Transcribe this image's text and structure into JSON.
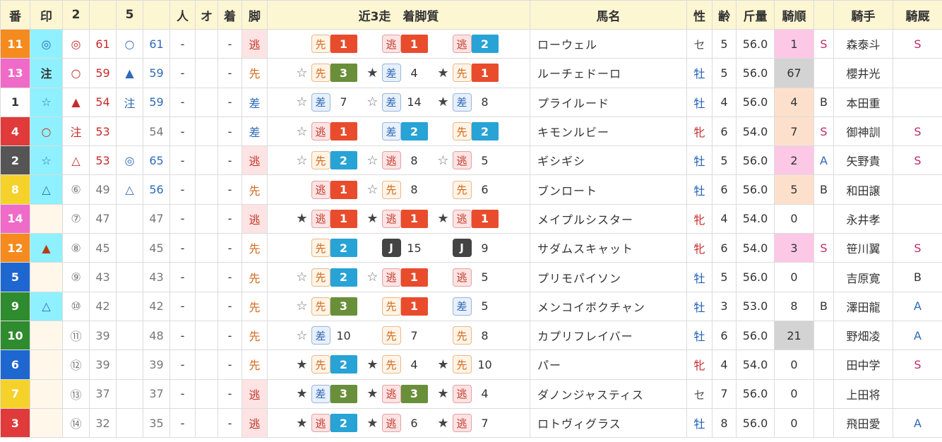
{
  "headers": [
    "番",
    "印",
    "2",
    "",
    "5",
    "",
    "人",
    "オ",
    "着",
    "脚",
    "近3走　着脚質",
    "馬名",
    "性",
    "齢",
    "斤量",
    "騎順",
    "",
    "騎手",
    "騎厩"
  ],
  "colors": {
    "white": "#ffffff",
    "black": "#222222",
    "red": "#e03a3a",
    "blue": "#1e66d0",
    "yellow": "#f5d22a",
    "green": "#2e8b2e",
    "orange": "#f58a1f",
    "pink": "#f06ac8",
    "grey": "#555555",
    "cyan": "#8ff0ff",
    "pos_red": "#e84c2d",
    "pos_blue": "#27a3d6",
    "pos_green": "#6a8f3a"
  },
  "rows": [
    {
      "num": "11",
      "num_color": "#f58a1f",
      "mark": "◎",
      "mark_cls": "",
      "m2": "◎",
      "s2": "61",
      "m5": "○",
      "s5": "61",
      "pop": "-",
      "o": "",
      "chaku": "-",
      "style": "逃",
      "style_cls": "nige",
      "r": [
        {
          "star": "",
          "st": "先",
          "p": "1",
          "pc": "#e84c2d"
        },
        {
          "star": "",
          "st": "逃",
          "p": "1",
          "pc": "#e84c2d"
        },
        {
          "star": "",
          "st": "逃",
          "p": "2",
          "pc": "#27a3d6"
        }
      ],
      "horse": "ローウェル",
      "sex": "セ",
      "sex_cls": "g",
      "age": "5",
      "kin": "56.0",
      "rank": "1",
      "rank_cls": "pink",
      "jk_grade": "S",
      "jockey": "森泰斗",
      "kyu": "S"
    },
    {
      "num": "13",
      "num_color": "#f06ac8",
      "mark": "注",
      "mark_cls": "",
      "m2": "○",
      "s2": "59",
      "m5": "▲",
      "s5": "59",
      "pop": "-",
      "o": "",
      "chaku": "-",
      "style": "先",
      "style_cls": "senk",
      "r": [
        {
          "star": "☆",
          "st": "先",
          "p": "3",
          "pc": "#6a8f3a"
        },
        {
          "star": "★",
          "st": "差",
          "p": "4",
          "pc": ""
        },
        {
          "star": "★",
          "st": "先",
          "p": "1",
          "pc": "#e84c2d"
        }
      ],
      "horse": "ルーチェドーロ",
      "sex": "牡",
      "sex_cls": "c",
      "age": "5",
      "kin": "56.0",
      "rank": "67",
      "rank_cls": "grey",
      "jk_grade": "",
      "jockey": "櫻井光",
      "kyu": ""
    },
    {
      "num": "1",
      "num_color": "#ffffff",
      "mark": "☆",
      "mark_cls": "",
      "m2": "▲",
      "s2": "54",
      "m5": "注",
      "s5": "59",
      "pop": "-",
      "o": "",
      "chaku": "-",
      "style": "差",
      "style_cls": "sash",
      "r": [
        {
          "star": "☆",
          "st": "差",
          "p": "7",
          "pc": ""
        },
        {
          "star": "☆",
          "st": "差",
          "p": "14",
          "pc": ""
        },
        {
          "star": "★",
          "st": "差",
          "p": "8",
          "pc": ""
        }
      ],
      "horse": "プライルード",
      "sex": "牡",
      "sex_cls": "c",
      "age": "4",
      "kin": "56.0",
      "rank": "4",
      "rank_cls": "peach",
      "jk_grade": "B",
      "jockey": "本田重",
      "kyu": ""
    },
    {
      "num": "4",
      "num_color": "#e03a3a",
      "mark": "○",
      "mark_cls": "",
      "m2": "注",
      "s2": "53",
      "m5": "",
      "s5": "54",
      "pop": "-",
      "o": "",
      "chaku": "-",
      "style": "差",
      "style_cls": "sash",
      "r": [
        {
          "star": "☆",
          "st": "逃",
          "p": "1",
          "pc": "#e84c2d"
        },
        {
          "star": "",
          "st": "差",
          "p": "2",
          "pc": "#27a3d6"
        },
        {
          "star": "",
          "st": "先",
          "p": "2",
          "pc": "#27a3d6"
        }
      ],
      "horse": "キモンルビー",
      "sex": "牝",
      "sex_cls": "f",
      "age": "6",
      "kin": "54.0",
      "rank": "7",
      "rank_cls": "peach",
      "jk_grade": "S",
      "jockey": "御神訓",
      "kyu": "S"
    },
    {
      "num": "2",
      "num_color": "#555555",
      "mark": "☆",
      "mark_cls": "",
      "m2": "△",
      "s2": "53",
      "m5": "◎",
      "s5": "65",
      "pop": "-",
      "o": "",
      "chaku": "-",
      "style": "逃",
      "style_cls": "nige",
      "r": [
        {
          "star": "☆",
          "st": "先",
          "p": "2",
          "pc": "#27a3d6"
        },
        {
          "star": "☆",
          "st": "逃",
          "p": "8",
          "pc": ""
        },
        {
          "star": "☆",
          "st": "逃",
          "p": "5",
          "pc": ""
        }
      ],
      "horse": "ギシギシ",
      "sex": "牡",
      "sex_cls": "c",
      "age": "5",
      "kin": "56.0",
      "rank": "2",
      "rank_cls": "pink",
      "jk_grade": "A",
      "jockey": "矢野貴",
      "kyu": "S"
    },
    {
      "num": "8",
      "num_color": "#f5d22a",
      "mark": "△",
      "mark_cls": "",
      "m2": "⑥",
      "s2": "49",
      "m5": "△",
      "s5": "56",
      "pop": "-",
      "o": "",
      "chaku": "-",
      "style": "先",
      "style_cls": "senk",
      "r": [
        {
          "star": "",
          "st": "逃",
          "p": "1",
          "pc": "#e84c2d"
        },
        {
          "star": "☆",
          "st": "先",
          "p": "8",
          "pc": ""
        },
        {
          "star": "",
          "st": "先",
          "p": "6",
          "pc": ""
        }
      ],
      "horse": "ブンロート",
      "sex": "牡",
      "sex_cls": "c",
      "age": "6",
      "kin": "56.0",
      "rank": "5",
      "rank_cls": "peach",
      "jk_grade": "B",
      "jockey": "和田譲",
      "kyu": ""
    },
    {
      "num": "14",
      "num_color": "#f06ac8",
      "mark": "",
      "mark_cls": "empty",
      "m2": "⑦",
      "s2": "47",
      "m5": "",
      "s5": "47",
      "pop": "-",
      "o": "",
      "chaku": "-",
      "style": "逃",
      "style_cls": "nige",
      "r": [
        {
          "star": "★",
          "st": "逃",
          "p": "1",
          "pc": "#e84c2d"
        },
        {
          "star": "★",
          "st": "逃",
          "p": "1",
          "pc": "#e84c2d"
        },
        {
          "star": "★",
          "st": "逃",
          "p": "1",
          "pc": "#e84c2d"
        }
      ],
      "horse": "メイプルシスター",
      "sex": "牝",
      "sex_cls": "f",
      "age": "4",
      "kin": "54.0",
      "rank": "0",
      "rank_cls": "",
      "jk_grade": "",
      "jockey": "永井孝",
      "kyu": ""
    },
    {
      "num": "12",
      "num_color": "#f58a1f",
      "mark": "▲",
      "mark_cls": "",
      "m2": "⑧",
      "s2": "45",
      "m5": "",
      "s5": "45",
      "pop": "-",
      "o": "",
      "chaku": "-",
      "style": "先",
      "style_cls": "senk",
      "r": [
        {
          "star": "",
          "st": "先",
          "p": "2",
          "pc": "#27a3d6"
        },
        {
          "star": "",
          "st": "J",
          "p": "15",
          "pc": ""
        },
        {
          "star": "",
          "st": "J",
          "p": "9",
          "pc": ""
        }
      ],
      "horse": "サダムスキャット",
      "sex": "牝",
      "sex_cls": "f",
      "age": "6",
      "kin": "54.0",
      "rank": "3",
      "rank_cls": "pink",
      "jk_grade": "S",
      "jockey": "笹川翼",
      "kyu": "S"
    },
    {
      "num": "5",
      "num_color": "#1e66d0",
      "mark": "",
      "mark_cls": "empty",
      "m2": "⑨",
      "s2": "43",
      "m5": "",
      "s5": "43",
      "pop": "-",
      "o": "",
      "chaku": "-",
      "style": "先",
      "style_cls": "senk",
      "r": [
        {
          "star": "☆",
          "st": "先",
          "p": "2",
          "pc": "#27a3d6"
        },
        {
          "star": "☆",
          "st": "逃",
          "p": "1",
          "pc": "#e84c2d"
        },
        {
          "star": "",
          "st": "逃",
          "p": "5",
          "pc": ""
        }
      ],
      "horse": "プリモパイソン",
      "sex": "牡",
      "sex_cls": "c",
      "age": "5",
      "kin": "56.0",
      "rank": "0",
      "rank_cls": "",
      "jk_grade": "",
      "jockey": "吉原寛",
      "kyu": "B"
    },
    {
      "num": "9",
      "num_color": "#2e8b2e",
      "mark": "△",
      "mark_cls": "",
      "m2": "⑩",
      "s2": "42",
      "m5": "",
      "s5": "42",
      "pop": "-",
      "o": "",
      "chaku": "-",
      "style": "先",
      "style_cls": "senk",
      "r": [
        {
          "star": "☆",
          "st": "先",
          "p": "3",
          "pc": "#6a8f3a"
        },
        {
          "star": "",
          "st": "先",
          "p": "1",
          "pc": "#e84c2d"
        },
        {
          "star": "",
          "st": "差",
          "p": "5",
          "pc": ""
        }
      ],
      "horse": "メンコイボクチャン",
      "sex": "牡",
      "sex_cls": "c",
      "age": "3",
      "kin": "53.0",
      "rank": "8",
      "rank_cls": "",
      "jk_grade": "B",
      "jockey": "澤田龍",
      "kyu": "A"
    },
    {
      "num": "10",
      "num_color": "#2e8b2e",
      "mark": "",
      "mark_cls": "empty",
      "m2": "⑪",
      "s2": "39",
      "m5": "",
      "s5": "48",
      "pop": "-",
      "o": "",
      "chaku": "-",
      "style": "先",
      "style_cls": "senk",
      "r": [
        {
          "star": "☆",
          "st": "差",
          "p": "10",
          "pc": ""
        },
        {
          "star": "",
          "st": "先",
          "p": "7",
          "pc": ""
        },
        {
          "star": "",
          "st": "先",
          "p": "8",
          "pc": ""
        }
      ],
      "horse": "カプリフレイバー",
      "sex": "牡",
      "sex_cls": "c",
      "age": "6",
      "kin": "56.0",
      "rank": "21",
      "rank_cls": "grey",
      "jk_grade": "",
      "jockey": "野畑凌",
      "kyu": "A"
    },
    {
      "num": "6",
      "num_color": "#1e66d0",
      "mark": "",
      "mark_cls": "empty",
      "m2": "⑫",
      "s2": "39",
      "m5": "",
      "s5": "39",
      "pop": "-",
      "o": "",
      "chaku": "-",
      "style": "先",
      "style_cls": "senk",
      "r": [
        {
          "star": "★",
          "st": "先",
          "p": "2",
          "pc": "#27a3d6"
        },
        {
          "star": "★",
          "st": "先",
          "p": "4",
          "pc": ""
        },
        {
          "star": "★",
          "st": "先",
          "p": "10",
          "pc": ""
        }
      ],
      "horse": "パー",
      "sex": "牝",
      "sex_cls": "f",
      "age": "4",
      "kin": "54.0",
      "rank": "0",
      "rank_cls": "",
      "jk_grade": "",
      "jockey": "田中学",
      "kyu": "S"
    },
    {
      "num": "7",
      "num_color": "#f5d22a",
      "mark": "",
      "mark_cls": "empty",
      "m2": "⑬",
      "s2": "37",
      "m5": "",
      "s5": "37",
      "pop": "-",
      "o": "",
      "chaku": "-",
      "style": "逃",
      "style_cls": "nige",
      "r": [
        {
          "star": "★",
          "st": "差",
          "p": "3",
          "pc": "#6a8f3a"
        },
        {
          "star": "★",
          "st": "逃",
          "p": "3",
          "pc": "#6a8f3a"
        },
        {
          "star": "★",
          "st": "逃",
          "p": "4",
          "pc": ""
        }
      ],
      "horse": "ダノンジャスティス",
      "sex": "セ",
      "sex_cls": "g",
      "age": "7",
      "kin": "56.0",
      "rank": "0",
      "rank_cls": "",
      "jk_grade": "",
      "jockey": "上田将",
      "kyu": ""
    },
    {
      "num": "3",
      "num_color": "#e03a3a",
      "mark": "",
      "mark_cls": "empty",
      "m2": "⑭",
      "s2": "32",
      "m5": "",
      "s5": "35",
      "pop": "-",
      "o": "",
      "chaku": "-",
      "style": "逃",
      "style_cls": "nige",
      "r": [
        {
          "star": "★",
          "st": "逃",
          "p": "2",
          "pc": "#27a3d6"
        },
        {
          "star": "★",
          "st": "逃",
          "p": "6",
          "pc": ""
        },
        {
          "star": "★",
          "st": "逃",
          "p": "7",
          "pc": ""
        }
      ],
      "horse": "ロトヴィグラス",
      "sex": "牡",
      "sex_cls": "c",
      "age": "8",
      "kin": "56.0",
      "rank": "0",
      "rank_cls": "",
      "jk_grade": "",
      "jockey": "飛田愛",
      "kyu": "A"
    }
  ]
}
